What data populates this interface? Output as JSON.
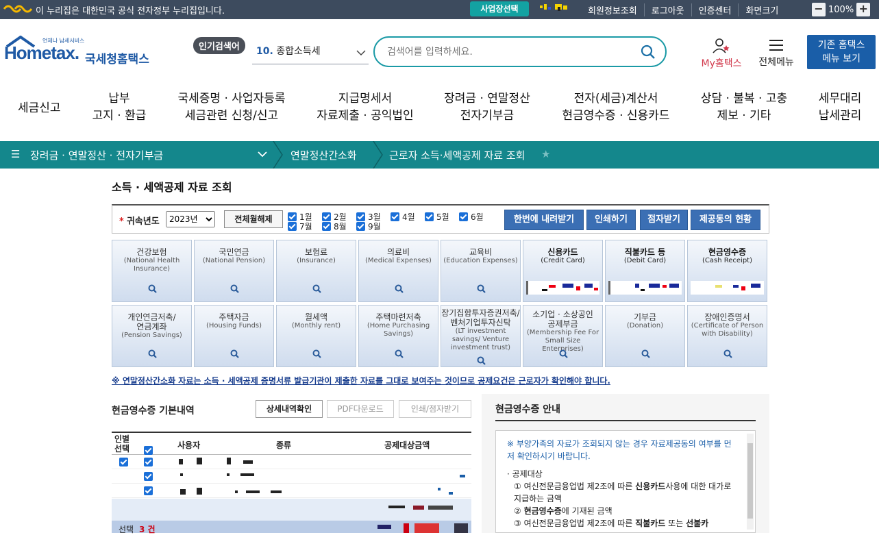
{
  "govbar": {
    "notice": "이 누리집은 대한민국 공식 전자정부 누리집입니다.",
    "biz_select": "사업장선택",
    "links": [
      "회원정보조회",
      "로그아웃",
      "인증센터",
      "화면크기"
    ],
    "zoom": "100%"
  },
  "header": {
    "logo_small": "언제나 납세서비스",
    "logo_main": "Hometax.",
    "logo_kr": "국세청홈택스",
    "popular_badge": "인기검색어",
    "popular_num": "10.",
    "popular_term": "종합소득세",
    "search_placeholder": "검색어를 입력하세요.",
    "my_home": "My홈택스",
    "all_menu": "전체메뉴",
    "old_home_line1": "기존 홈택스",
    "old_home_line2": "메뉴 보기"
  },
  "nav": [
    {
      "l1": "세금신고",
      "l2": ""
    },
    {
      "l1": "납부",
      "l2": "고지 · 환급"
    },
    {
      "l1": "국세증명 · 사업자등록",
      "l2": "세금관련 신청/신고"
    },
    {
      "l1": "지급명세서",
      "l2": "자료제출 · 공익법인"
    },
    {
      "l1": "장려금 · 연말정산",
      "l2": "전자기부금"
    },
    {
      "l1": "전자(세금)계산서",
      "l2": "현금영수증 · 신용카드"
    },
    {
      "l1": "상담 · 불복 · 고충",
      "l2": "제보 · 기타"
    },
    {
      "l1": "세무대리",
      "l2": "납세관리"
    }
  ],
  "breadcrumb": {
    "c1": "장려금 · 연말정산 · 전자기부금",
    "c2": "연말정산간소화",
    "c3": "근로자 소득·세액공제 자료 조회"
  },
  "page": {
    "title": "소득 · 세액공제 자료 조회",
    "year_label": "귀속년도",
    "year_value": "2023년",
    "clear_all": "전체월해제",
    "months": [
      "1월",
      "2월",
      "3월",
      "4월",
      "5월",
      "6월",
      "7월",
      "8월",
      "9월"
    ],
    "btn_download": "한번에 내려받기",
    "btn_print": "인쇄하기",
    "btn_braille": "점자받기",
    "btn_share": "제공동의 현황",
    "note": "※ 연말정산간소화 자료는 소득 · 세액공제 증명서류 발급기관이 제출한 자료를 그대로 보여주는 것이므로 공제요건은 근로자가 확인해야 합니다."
  },
  "tiles": [
    {
      "t1": "건강보험",
      "t2": "(National Health Insurance)"
    },
    {
      "t1": "국민연금",
      "t2": "(National Pension)"
    },
    {
      "t1": "보험료",
      "t2": "(Insurance)"
    },
    {
      "t1": "의료비",
      "t2": "(Medical Expenses)"
    },
    {
      "t1": "교육비",
      "t2": "(Education Expenses)"
    },
    {
      "t1": "신용카드",
      "t2": "(Credit Card)"
    },
    {
      "t1": "직불카드 등",
      "t2": "(Debit Card)"
    },
    {
      "t1": "현금영수증",
      "t2": "(Cash Receipt)"
    },
    {
      "t1": "개인연금저축/\n연금계좌",
      "t2": "(Pension Savings)"
    },
    {
      "t1": "주택자금",
      "t2": "(Housing Funds)"
    },
    {
      "t1": "월세액",
      "t2": "(Monthly rent)"
    },
    {
      "t1": "주택마련저축",
      "t2": "(Home Purchasing Savings)"
    },
    {
      "t1": "장기집합투자증권저축/\n벤처기업투자신탁",
      "t2": "(LT investment savings/ Venture investment trust)"
    },
    {
      "t1": "소기업 · 소상공인\n공제부금",
      "t2": "(Membership Fee For Small Size Enterprises)"
    },
    {
      "t1": "기부금",
      "t2": "(Donation)"
    },
    {
      "t1": "장애인증명서",
      "t2": "(Certificate of Person with Disability)"
    }
  ],
  "left": {
    "title": "현금영수증 기본내역",
    "btn_detail": "상세내역확인",
    "btn_pdf": "PDF다운로드",
    "btn_printb": "인쇄/점자받기",
    "col_sel1": "인별",
    "col_sel2": "선택",
    "col_user": "사용자",
    "col_type": "종류",
    "col_amount": "공제대상금액",
    "sel_label": "선택",
    "sel_count": "3 건"
  },
  "right": {
    "title": "현금영수증 안내",
    "warn": "※ 부양가족의 자료가 조회되지 않는 경우 자료제공동의 여부를 먼저 확인하시기 바랍니다.",
    "bullet": "공제대상",
    "line1a": "① 여신전문금융업법 제2조에 따른 ",
    "line1b": "신용카드",
    "line1c": "사용에 대한 대가로 지급하는 금액",
    "line2a": "② ",
    "line2b": "현금영수증",
    "line2c": "에 기재된 금액",
    "line3a": "③ 여신전문금융업법 제2조에 따른 ",
    "line3b": "직불카드",
    "line3c": " 또는 ",
    "line3d": "선불카"
  },
  "colors": {
    "teal": "#14878c",
    "navy": "#1a5ea8",
    "button_blue": "#3b6fb4"
  }
}
